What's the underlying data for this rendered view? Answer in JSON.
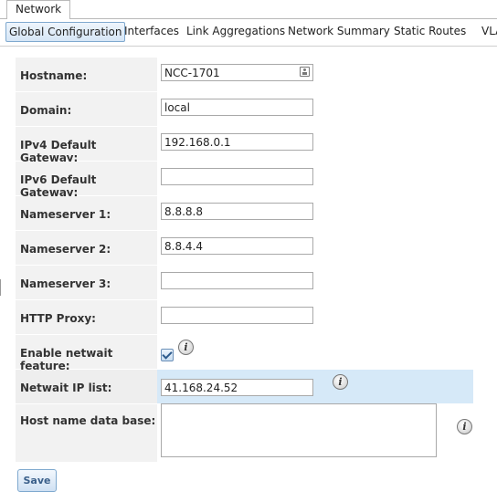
{
  "top_tab": {
    "label": "Network"
  },
  "subtabs": [
    {
      "label": "Global Configuration",
      "active": true
    },
    {
      "label": "Interfaces",
      "active": false
    },
    {
      "label": "Link Aggregations",
      "active": false
    },
    {
      "label": "Network Summary",
      "active": false
    },
    {
      "label": "Static Routes",
      "active": false
    },
    {
      "label": "VLA",
      "active": false
    }
  ],
  "form": {
    "hostname": {
      "label": "Hostname:",
      "value": "NCC-1701"
    },
    "domain": {
      "label": "Domain:",
      "value": "local"
    },
    "ipv4_gateway": {
      "label": "IPv4 Default Gateway:",
      "value": "192.168.0.1"
    },
    "ipv6_gateway": {
      "label": "IPv6 Default Gateway:",
      "value": ""
    },
    "nameserver1": {
      "label": "Nameserver 1:",
      "value": "8.8.8.8"
    },
    "nameserver2": {
      "label": "Nameserver 2:",
      "value": "8.8.4.4"
    },
    "nameserver3": {
      "label": "Nameserver 3:",
      "value": ""
    },
    "http_proxy": {
      "label": "HTTP Proxy:",
      "value": ""
    },
    "netwait_enable": {
      "label": "Enable netwait feature:",
      "checked": true
    },
    "netwait_ips": {
      "label": "Netwait IP list:",
      "value": "41.168.24.52"
    },
    "hosts_db": {
      "label": "Host name data base:",
      "value": ""
    }
  },
  "info_glyph": "i",
  "icons": {
    "hostname_field": "contact-card-icon",
    "help": "info-icon"
  },
  "colors": {
    "highlight_row": "#d6e9f8",
    "label_bg": "#f2f2f2",
    "accent": "#7fa9cf"
  },
  "buttons": {
    "save": "Save"
  }
}
